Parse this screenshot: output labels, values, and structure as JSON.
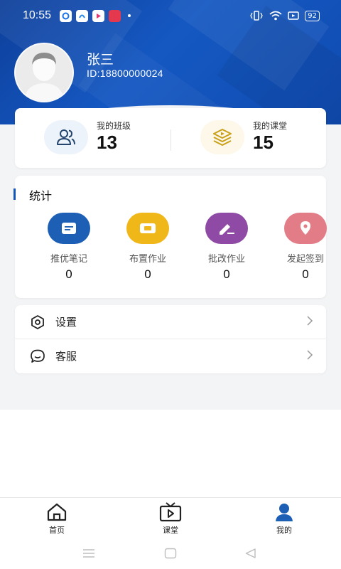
{
  "status_bar": {
    "time": "10:55",
    "battery": "92"
  },
  "profile": {
    "name": "张三",
    "id_text": "ID:18800000024"
  },
  "summary": {
    "classes": {
      "label": "我的班级",
      "value": "13"
    },
    "lessons": {
      "label": "我的课堂",
      "value": "15"
    }
  },
  "stats": {
    "title": "统计",
    "items": [
      {
        "label": "推优笔记",
        "value": "0",
        "color": "#1e5fb6"
      },
      {
        "label": "布置作业",
        "value": "0",
        "color": "#f0b718"
      },
      {
        "label": "批改作业",
        "value": "0",
        "color": "#8e4aa4"
      },
      {
        "label": "发起签到",
        "value": "0",
        "color": "#e27c86"
      }
    ]
  },
  "menu": {
    "settings": "设置",
    "service": "客服"
  },
  "tabs": [
    {
      "label": "首页",
      "icon": "home-icon"
    },
    {
      "label": "课堂",
      "icon": "tv-play-icon"
    },
    {
      "label": "我的",
      "icon": "person-icon"
    }
  ],
  "colors": {
    "primary": "#1256b8",
    "active_tab": "#1e5fb6"
  }
}
